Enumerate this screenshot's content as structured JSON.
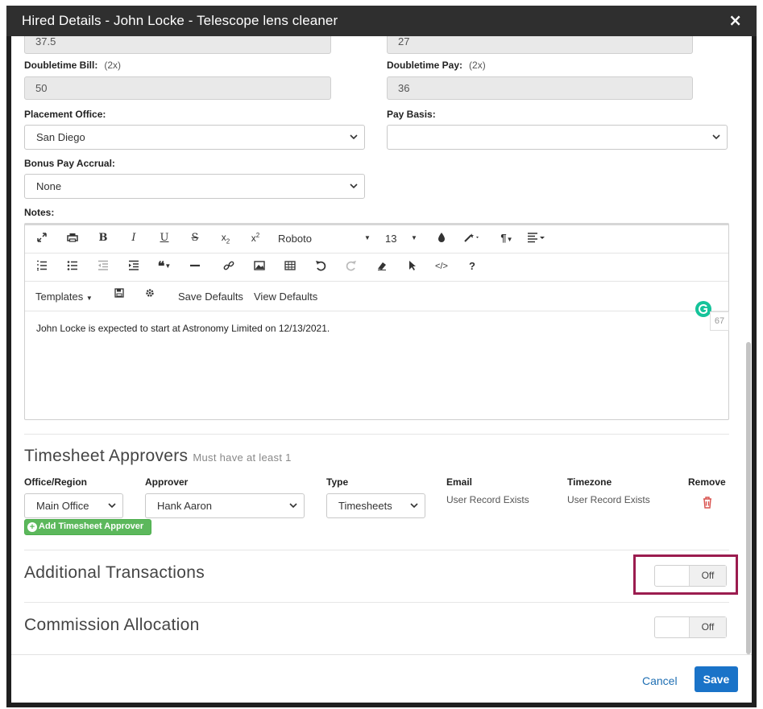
{
  "modal": {
    "title": "Hired Details - John Locke - Telescope lens cleaner",
    "close_symbol": "×"
  },
  "rates": {
    "prev_bill_value": "37.5",
    "prev_pay_value": "27",
    "doubletime_bill_label": "Doubletime Bill:",
    "doubletime_bill_mult": "(2x)",
    "doubletime_bill_value": "50",
    "doubletime_pay_label": "Doubletime Pay:",
    "doubletime_pay_mult": "(2x)",
    "doubletime_pay_value": "36"
  },
  "placement": {
    "office_label": "Placement Office:",
    "office_value": "San Diego",
    "pay_basis_label": "Pay Basis:",
    "pay_basis_value": "",
    "bonus_label": "Bonus Pay Accrual:",
    "bonus_value": "None"
  },
  "notes": {
    "label": "Notes:",
    "font_name": "Roboto",
    "font_size": "13",
    "templates_label": "Templates",
    "save_defaults_label": "Save Defaults",
    "view_defaults_label": "View Defaults",
    "body_text": "John Locke is expected to start at Astronomy Limited on 12/13/2021.",
    "char_count": "67"
  },
  "approvers": {
    "title": "Timesheet Approvers",
    "hint": "Must have at least 1",
    "columns": {
      "office_region": "Office/Region",
      "approver": "Approver",
      "type": "Type",
      "email": "Email",
      "timezone": "Timezone",
      "remove": "Remove"
    },
    "row": {
      "office_region": "Main Office",
      "approver": "Hank Aaron",
      "type": "Timesheets",
      "email": "User Record Exists",
      "timezone": "User Record Exists"
    },
    "add_button": "Add Timesheet Approver"
  },
  "additional_transactions": {
    "title": "Additional Transactions",
    "toggle_state": "Off"
  },
  "commission_allocation": {
    "title": "Commission Allocation",
    "toggle_state": "Off"
  },
  "footer": {
    "cancel_label": "Cancel",
    "save_label": "Save"
  },
  "colors": {
    "title_bar": "#2f2f2f",
    "save_button": "#1a73c8",
    "add_button": "#5cb85c",
    "highlight": "#9b1c4f",
    "remove_icon": "#d9534f"
  }
}
